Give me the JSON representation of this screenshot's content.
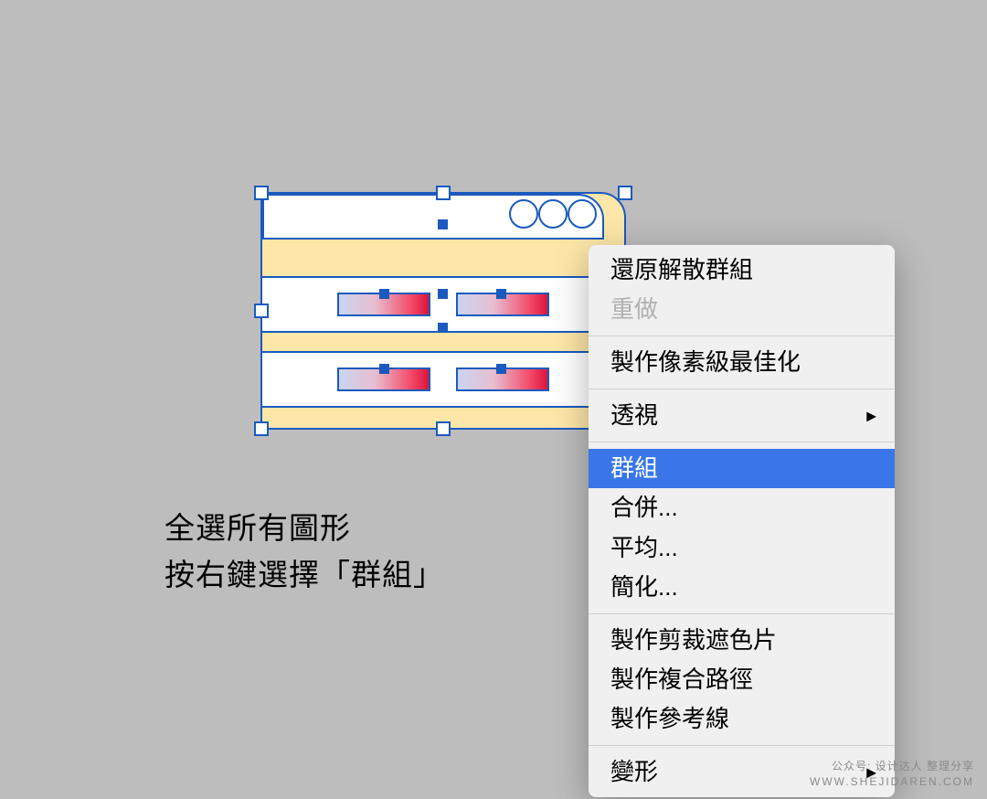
{
  "instruction": {
    "line1": "全選所有圖形",
    "line2": "按右鍵選擇「群組」"
  },
  "menu": {
    "undo_ungroup": "還原解散群組",
    "redo": "重做",
    "pixel_perfect": "製作像素級最佳化",
    "perspective": "透視",
    "group": "群組",
    "merge": "合併...",
    "average": "平均...",
    "simplify": "簡化...",
    "make_clipping_mask": "製作剪裁遮色片",
    "make_compound_path": "製作複合路徑",
    "make_guides": "製作參考線",
    "transform": "變形"
  },
  "watermark": {
    "line1": "公众号: 设计达人 整理分享",
    "line2": "WWW.SHEJIDAREN.COM"
  }
}
